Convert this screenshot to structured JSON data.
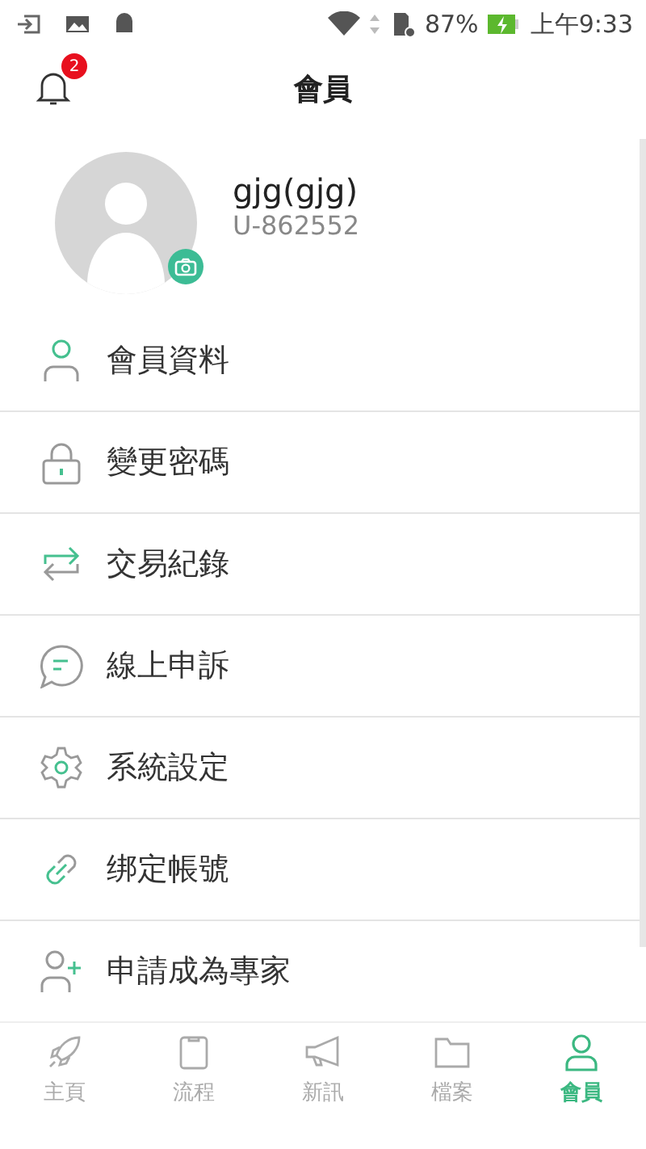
{
  "status_bar": {
    "battery": "87%",
    "time": "上午9:33"
  },
  "header": {
    "title": "會員",
    "notification_count": "2"
  },
  "profile": {
    "name": "gjg(gjg)",
    "user_id": "U-862552"
  },
  "menu": [
    {
      "label": "會員資料",
      "kind": "person"
    },
    {
      "label": "變更密碼",
      "kind": "lock"
    },
    {
      "label": "交易紀錄",
      "kind": "swap"
    },
    {
      "label": "線上申訴",
      "kind": "chat"
    },
    {
      "label": "系統設定",
      "kind": "gear"
    },
    {
      "label": "绑定帳號",
      "kind": "link"
    },
    {
      "label": "申請成為專家",
      "kind": "add-person"
    }
  ],
  "tabs": [
    {
      "label": "主頁",
      "kind": "rocket",
      "selected": false
    },
    {
      "label": "流程",
      "kind": "clipboard",
      "selected": false
    },
    {
      "label": "新訊",
      "kind": "megaphone",
      "selected": false
    },
    {
      "label": "檔案",
      "kind": "folder",
      "selected": false
    },
    {
      "label": "會員",
      "kind": "person",
      "selected": true
    }
  ]
}
